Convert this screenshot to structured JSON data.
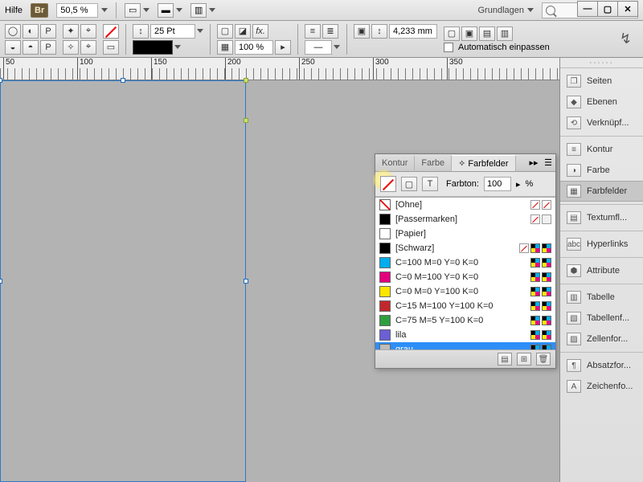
{
  "menubar": {
    "help": "Hilfe",
    "bridge_badge": "Br",
    "zoom": "50,5 %",
    "workspace": "Grundlagen"
  },
  "win": {
    "min": "—",
    "max": "▢",
    "close": "✕"
  },
  "controlbar": {
    "stroke_pt": "25 Pt",
    "opacity": "100 %",
    "frame_w": "4,233 mm",
    "autofit": "Automatisch einpassen"
  },
  "ruler": {
    "majors": [
      "50",
      "100",
      "150",
      "200",
      "250",
      "300",
      "350"
    ]
  },
  "swatch_panel": {
    "tabs": [
      "Kontur",
      "Farbe",
      "Farbfelder"
    ],
    "active_tab": 2,
    "tint_label": "Farbton:",
    "tint_value": "100",
    "tint_unit": "%",
    "items": [
      {
        "name": "[Ohne]",
        "color": "none",
        "icons": [
          "nolock",
          "none"
        ],
        "none": true
      },
      {
        "name": "[Passermarken]",
        "color": "#000000",
        "icons": [
          "nolock",
          "global"
        ]
      },
      {
        "name": "[Papier]",
        "color": "#ffffff",
        "icons": []
      },
      {
        "name": "[Schwarz]",
        "color": "#000000",
        "icons": [
          "nolock",
          "cmyk",
          "cmyk"
        ]
      },
      {
        "name": "C=100 M=0 Y=0 K=0",
        "color": "#00adee",
        "icons": [
          "cmyk",
          "cmyk"
        ]
      },
      {
        "name": "C=0 M=100 Y=0 K=0",
        "color": "#e5007d",
        "icons": [
          "cmyk",
          "cmyk"
        ]
      },
      {
        "name": "C=0 M=0 Y=100 K=0",
        "color": "#ffe600",
        "icons": [
          "cmyk",
          "cmyk"
        ]
      },
      {
        "name": "C=15 M=100 Y=100 K=0",
        "color": "#c1272d",
        "icons": [
          "cmyk",
          "cmyk"
        ]
      },
      {
        "name": "C=75 M=5 Y=100 K=0",
        "color": "#2f9e3f",
        "icons": [
          "cmyk",
          "cmyk"
        ]
      },
      {
        "name": "lila",
        "color": "#6b5fd4",
        "icons": [
          "cmyk",
          "cmyk"
        ]
      },
      {
        "name": "grau",
        "color": "#bdbdbd",
        "icons": [
          "cmyk",
          "cmyk"
        ],
        "selected": true
      }
    ]
  },
  "dock": {
    "groups": [
      [
        "Seiten",
        "Ebenen",
        "Verknüpf..."
      ],
      [
        "Kontur",
        "Farbe",
        "Farbfelder"
      ],
      [
        "Textumfl..."
      ],
      [
        "Hyperlinks"
      ],
      [
        "Attribute"
      ],
      [
        "Tabelle",
        "Tabellenf...",
        "Zellenfor..."
      ],
      [
        "Absatzfor...",
        "Zeichenfo..."
      ]
    ],
    "active": "Farbfelder",
    "icons": {
      "Seiten": "❐",
      "Ebenen": "◆",
      "Verknüpf...": "⟲",
      "Kontur": "≡",
      "Farbe": "◑",
      "Farbfelder": "▦",
      "Textumfl...": "▤",
      "Hyperlinks": "abc",
      "Attribute": "⬢",
      "Tabelle": "▥",
      "Tabellenf...": "▧",
      "Zellenfor...": "▨",
      "Absatzfor...": "¶",
      "Zeichenfo...": "A"
    }
  }
}
